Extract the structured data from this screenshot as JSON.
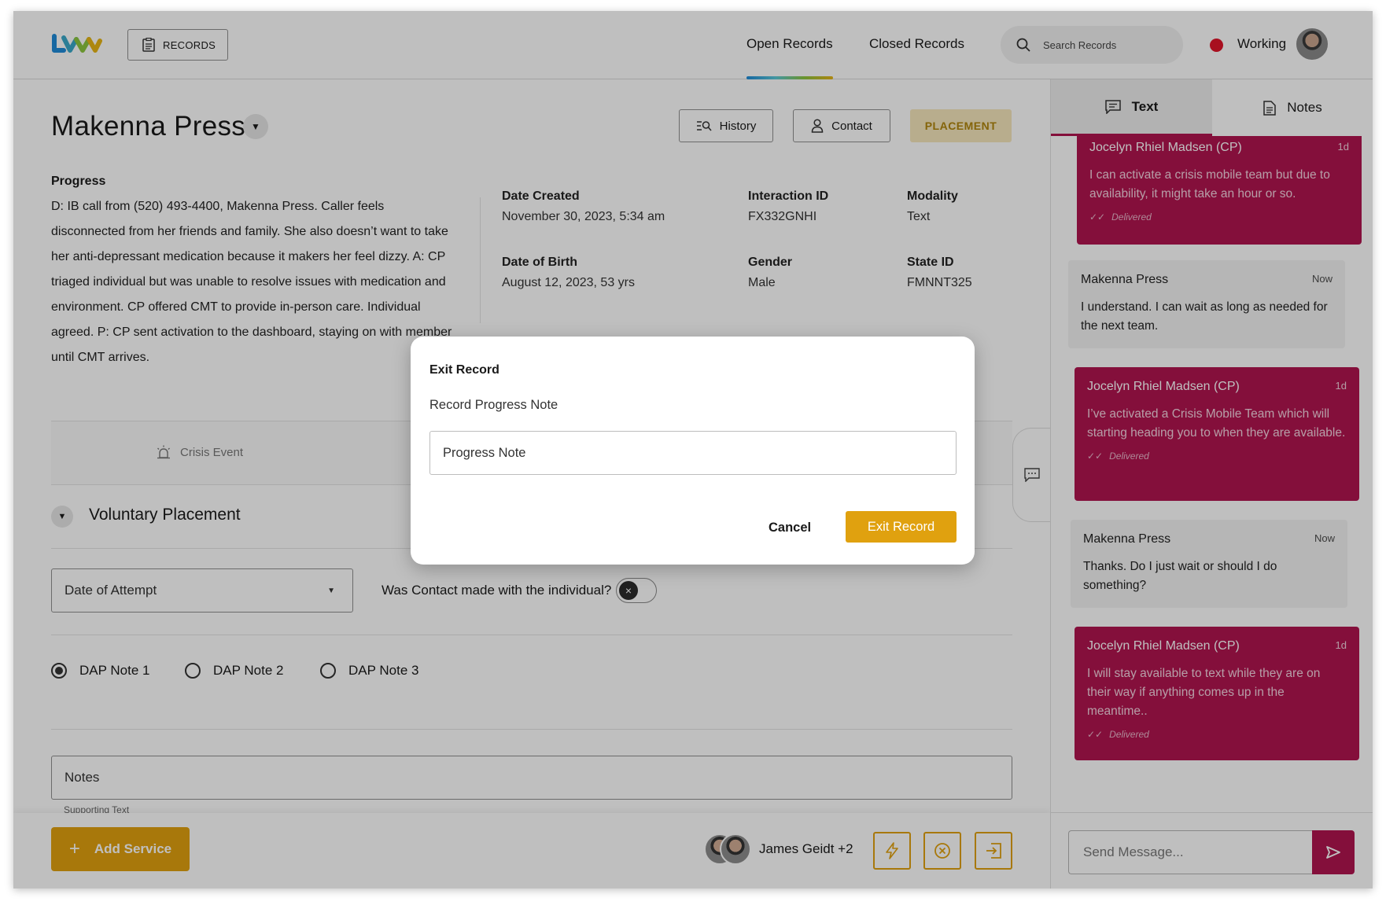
{
  "header": {
    "records_label": "RECORDS",
    "nav": {
      "open": "Open Records",
      "closed": "Closed Records"
    },
    "search_placeholder": "Search Records",
    "status": "Working",
    "status_color": "#e1142a",
    "brand_colors": [
      "#1f8bd9",
      "#8cc63f",
      "#e7b416"
    ]
  },
  "record": {
    "name": "Makenna Press",
    "buttons": {
      "history": "History",
      "contact": "Contact",
      "placement": "PLACEMENT"
    },
    "progress_title": "Progress",
    "progress_text": "D: IB call from (520) 493-4400, Makenna Press. Caller feels disconnected from her friends and family. She also doesn’t want to take her anti-depressant medication because it makers her feel dizzy. A: CP triaged individual but was unable to resolve issues with medication and environment. CP offered CMT to provide in-person care. Individual agreed. P:  CP sent activation to the dashboard, staying on with member until CMT arrives.",
    "fields": {
      "date_created": {
        "label": "Date Created",
        "value": "November 30, 2023, 5:34 am"
      },
      "interaction_id": {
        "label": "Interaction ID",
        "value": "FX332GNHI"
      },
      "modality": {
        "label": "Modality",
        "value": "Text"
      },
      "dob": {
        "label": "Date of Birth",
        "value": "August 12, 2023, 53 yrs"
      },
      "gender": {
        "label": "Gender",
        "value": "Male"
      },
      "state_id": {
        "label": "State ID",
        "value": "FMNNT325"
      }
    },
    "crisis_event": "Crisis Event",
    "section_title": "Voluntary Placement",
    "date_of_attempt": "Date of Attempt",
    "contact_question": "Was Contact made with the individual?",
    "contact_made": false,
    "dap_notes": [
      {
        "label": "DAP Note 1",
        "checked": true
      },
      {
        "label": "DAP Note 2",
        "checked": false
      },
      {
        "label": "DAP Note 3",
        "checked": false
      }
    ],
    "notes_label": "Notes",
    "supporting_text": "Supporting Text"
  },
  "footer": {
    "add_service": "Add Service",
    "team": "James Geidt +2",
    "accent": "#e0a10f"
  },
  "panel": {
    "tabs": {
      "text": "Text",
      "notes": "Notes"
    },
    "accent": "#b1144f",
    "messages": [
      {
        "sender": "Jocelyn Rhiel Madsen (CP)",
        "time": "1d",
        "body": "I can activate a crisis mobile team but due to availability, it might take an hour or so.",
        "status": "Delivered"
      },
      {
        "sender": "Makenna Press",
        "time": "Now",
        "body": "I understand. I can wait as long as needed for the next team."
      },
      {
        "sender": "Jocelyn Rhiel Madsen (CP)",
        "time": "1d",
        "body": "I’ve activated a Crisis Mobile Team which will starting heading you to when they are available.",
        "status": "Delivered"
      },
      {
        "sender": "Makenna Press",
        "time": "Now",
        "body": "Thanks. Do I just wait or should I do something?"
      },
      {
        "sender": "Jocelyn Rhiel Madsen (CP)",
        "time": "1d",
        "body": "I will stay available to text while they are on their way if anything comes up in the meantime..",
        "status": "Delivered"
      }
    ],
    "send_placeholder": "Send Message..."
  },
  "modal": {
    "title": "Exit Record",
    "subtitle": "Record Progress Note",
    "input_placeholder": "Progress Note",
    "cancel": "Cancel",
    "confirm": "Exit Record"
  }
}
